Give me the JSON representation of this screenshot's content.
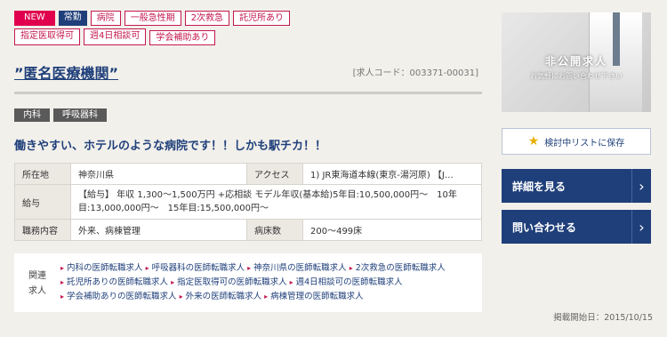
{
  "badges": {
    "new": "NEW",
    "type": "常勤"
  },
  "tags": [
    "病院",
    "一般急性期",
    "2次救急",
    "託児所あり",
    "指定医取得可",
    "週4日相談可",
    "学会補助あり"
  ],
  "title": "”匿名医療機関”",
  "job_code": "[求人コード：003371-00031]",
  "specialties": [
    "内科",
    "呼吸器科"
  ],
  "headline": "働きやすい、ホテルのような病院です！！しかも駅チカ！！",
  "info": {
    "location_label": "所在地",
    "location": "神奈川県",
    "access_label": "アクセス",
    "access": "1) JR東海道本線(東京-湯河原) 【J…",
    "salary_label": "給与",
    "salary": "【給与】 年収 1,300～1,500万円 +応相談 モデル年収(基本給)5年目:10,500,000円～　10年目:13,000,000円～　15年目:15,500,000円～",
    "duties_label": "職務内容",
    "duties": "外来、病棟管理",
    "beds_label": "病床数",
    "beds": "200～499床"
  },
  "related": {
    "label": "関連求人",
    "links": [
      "内科の医師転職求人",
      "呼吸器科の医師転職求人",
      "神奈川県の医師転職求人",
      "2次救急の医師転職求人",
      "託児所ありの医師転職求人",
      "指定医取得可の医師転職求人",
      "週4日相談可の医師転職求人",
      "学会補助ありの医師転職求人",
      "外来の医師転職求人",
      "病棟管理の医師転職求人"
    ]
  },
  "sidebar": {
    "hero_title": "非公開求人",
    "hero_sub": "お気軽にお問い合わせ下さい",
    "save_label": "検討中リストに保存",
    "details_label": "詳細を見る",
    "contact_label": "問い合わせる"
  },
  "posted": "掲載開始日：2015/10/15",
  "colors": {
    "navy": "#1f3f7a",
    "accent": "#c4184f",
    "new": "#e0004d"
  }
}
